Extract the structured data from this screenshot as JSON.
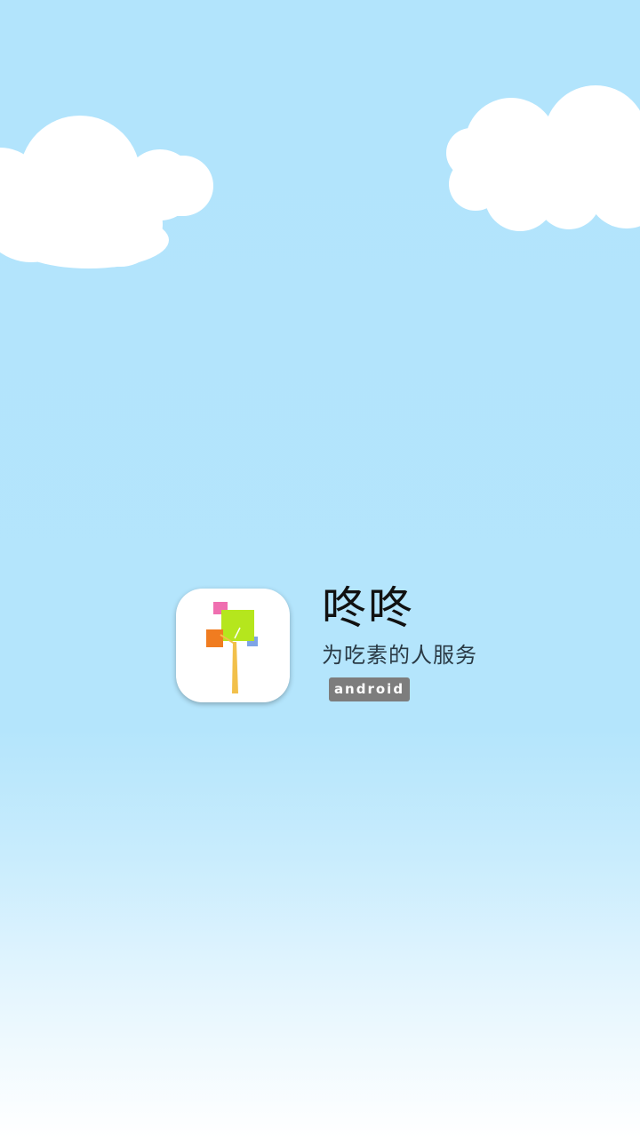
{
  "app": {
    "name": "咚咚",
    "slogan": "为吃素的人服务",
    "platform_badge": "ANDROID",
    "icon": "tree-icon"
  },
  "colors": {
    "sky_top": "#b2e4fc",
    "sky_bottom": "#ffffff",
    "cloud": "#ffffff",
    "badge_bg": "#7d7d7d",
    "tree_green": "#b5e61d",
    "tree_orange": "#f07c20",
    "tree_pink": "#ef6fb0",
    "tree_blue": "#7fa4e6",
    "tree_trunk": "#f2c04a"
  }
}
